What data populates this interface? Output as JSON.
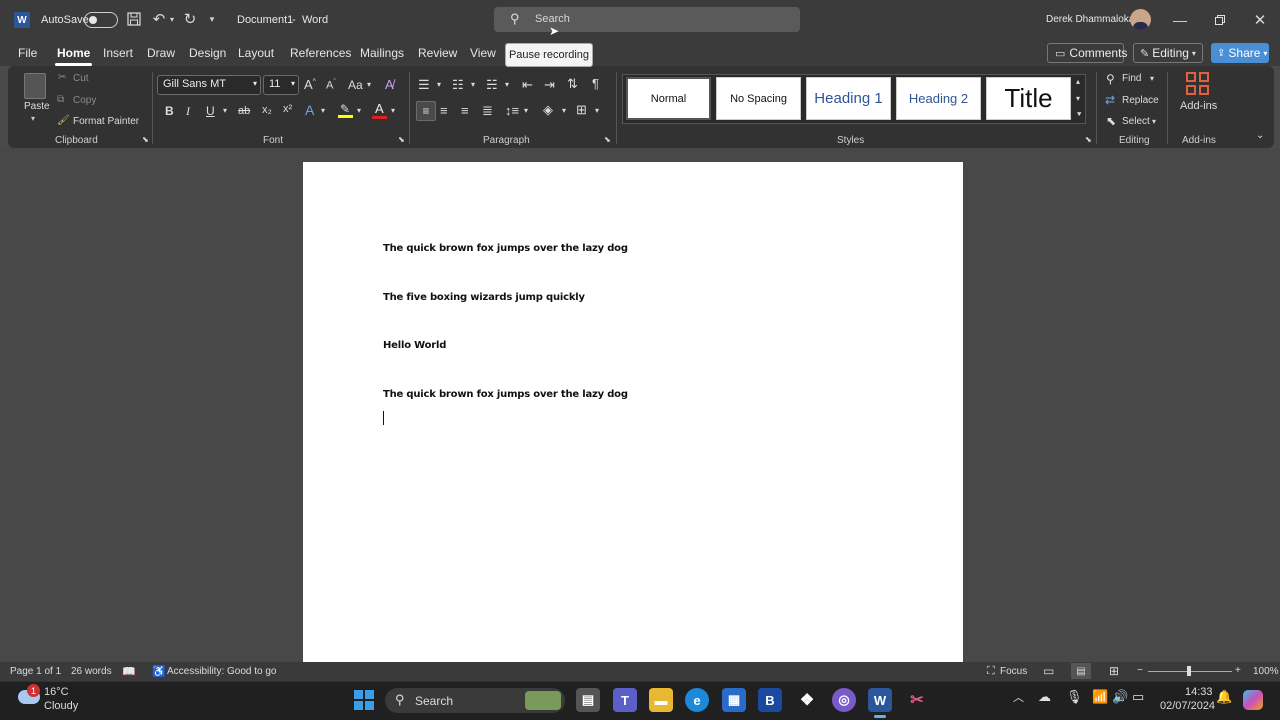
{
  "titlebar": {
    "autosave_label": "AutoSave",
    "doc_title": "Document1",
    "app_sep": "-",
    "app_name": "Word",
    "search_placeholder": "Search",
    "user_name": "Derek Dhammaloka"
  },
  "tooltip": {
    "text": "Pause recording"
  },
  "menu": {
    "tabs": [
      "File",
      "Home",
      "Insert",
      "Draw",
      "Design",
      "Layout",
      "References",
      "Mailings",
      "Review",
      "View"
    ],
    "comments_label": "Comments",
    "editing_label": "Editing",
    "share_label": "Share"
  },
  "ribbon": {
    "clipboard": {
      "paste": "Paste",
      "cut": "Cut",
      "copy": "Copy",
      "format_painter": "Format Painter",
      "group": "Clipboard"
    },
    "font": {
      "name": "Gill Sans MT",
      "size": "11",
      "change_case": "Aa",
      "bold": "B",
      "italic": "I",
      "underline": "U",
      "strike": "ab",
      "sub": "x₂",
      "sup": "x²",
      "group": "Font"
    },
    "paragraph": {
      "group": "Paragraph"
    },
    "styles": {
      "items": [
        "Normal",
        "No Spacing",
        "Heading 1",
        "Heading 2",
        "Title"
      ],
      "group": "Styles"
    },
    "editing": {
      "find": "Find",
      "replace": "Replace",
      "select": "Select",
      "group": "Editing"
    },
    "addins": {
      "label": "Add-ins",
      "group": "Add-ins"
    }
  },
  "document": {
    "lines": [
      "The quick brown fox jumps over the lazy dog",
      "The five boxing wizards jump quickly",
      "Hello World",
      "The quick brown fox jumps over the lazy dog"
    ]
  },
  "status": {
    "page": "Page 1 of 1",
    "words": "26 words",
    "accessibility": "Accessibility: Good to go",
    "focus": "Focus",
    "zoom": "100%",
    "zoom_minus": "−",
    "zoom_plus": "+"
  },
  "taskbar": {
    "weather_temp": "16°C",
    "weather_desc": "Cloudy",
    "weather_badge": "1",
    "search": "Search",
    "time": "14:33",
    "date": "02/07/2024"
  },
  "colors": {
    "accent": "#2b579a",
    "share": "#4a8fd6",
    "ribbon_bg": "#323232",
    "title_bg": "#3b3b3b"
  }
}
